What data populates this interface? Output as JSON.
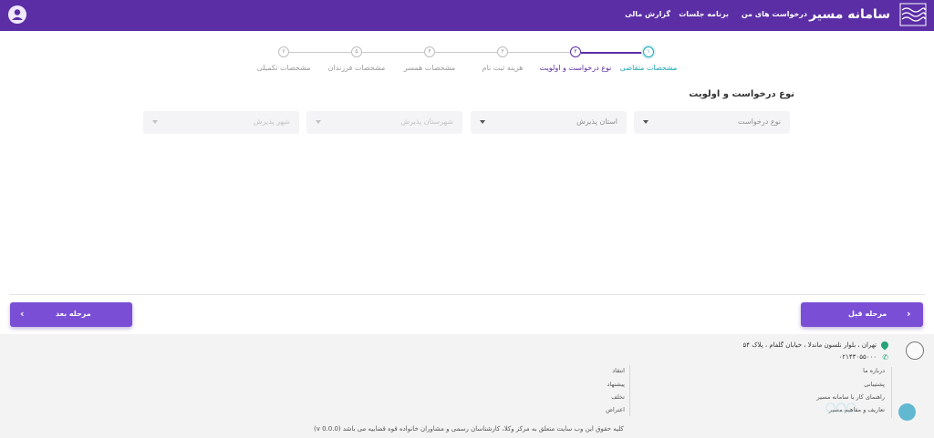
{
  "header": {
    "brand": "سامانه مسیر",
    "nav": [
      "درخواست های من",
      "برنامه جلسات",
      "گزارش مالی"
    ],
    "bg_color": "#5b2ea6"
  },
  "stepper": {
    "steps": [
      {
        "num": "۱",
        "label": "مشخصات متقاضی",
        "state": "active"
      },
      {
        "num": "۲",
        "label": "نوع درخواست و اولویت",
        "state": "current"
      },
      {
        "num": "۳",
        "label": "هزینه ثبت نام",
        "state": "pending"
      },
      {
        "num": "۴",
        "label": "مشخصات همسر",
        "state": "pending"
      },
      {
        "num": "۵",
        "label": "مشخصات فرزندان",
        "state": "pending"
      },
      {
        "num": "۶",
        "label": "مشخصات تکمیلی",
        "state": "pending"
      }
    ]
  },
  "form": {
    "title": "نوع درخواست و اولویت",
    "request_type": "نوع درخواست",
    "province": "استان پذیرش",
    "county": "شهرستان پذیرش",
    "city": "شهر پذیرش"
  },
  "buttons": {
    "prev": "مرحله قبل",
    "next": "مرحله بعد",
    "color": "#7a4fd6"
  },
  "footer": {
    "address": "تهران ، بلوار نلسون ماندلا ، خیابان گلفام ، پلاک ۵۴",
    "phone": "۰۲۱۴۳۰۵۵۰۰۰",
    "links_right": [
      "درباره ما",
      "پشتیبانی",
      "راهنمای کار با سامانه مسیر",
      "تعاریف و مفاهیم مسیر"
    ],
    "links_left": [
      "انتقاد",
      "پیشنهاد",
      "تخلف",
      "اعتراض"
    ],
    "copyright": "کلیه حقوق این وب سایت متعلق به مرکز وکلا، کارشناسان رسمی و مشاوران خانواده قوه قضاییه می باشد (v 0.0.0)"
  }
}
